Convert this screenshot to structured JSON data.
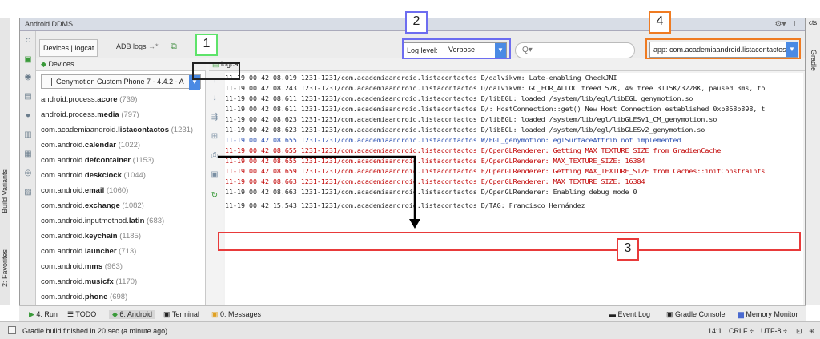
{
  "window": {
    "title": "Android DDMS"
  },
  "right_tab": {
    "label": "Gradle",
    "top_label": "cts"
  },
  "left_tabs": {
    "build_variants": "Build Variants",
    "favorites": "2: Favorites"
  },
  "toolbar": {
    "devices_tab": "Devices | logcat",
    "adb_logs_tab": "ADB logs",
    "log_level_label": "Log level:",
    "log_level_value": "Verbose",
    "search_placeholder": "Q▾",
    "app_filter": "app: com.academiaandroid.listacontactos"
  },
  "devices": {
    "header": "Devices",
    "selected": "Genymotion Custom Phone 7 - 4.4.2 - A",
    "processes": [
      {
        "pre": "android.process.",
        "bold": "acore",
        "post": "",
        "pid": "(739)"
      },
      {
        "pre": "android.process.",
        "bold": "media",
        "post": "",
        "pid": "(797)"
      },
      {
        "pre": "com.academiaandroid.",
        "bold": "listacontactos",
        "post": "",
        "pid": "(1231)"
      },
      {
        "pre": "com.android.",
        "bold": "calendar",
        "post": "",
        "pid": "(1022)"
      },
      {
        "pre": "com.android.",
        "bold": "defcontainer",
        "post": "",
        "pid": "(1153)"
      },
      {
        "pre": "com.android.",
        "bold": "deskclock",
        "post": "",
        "pid": "(1044)"
      },
      {
        "pre": "com.android.",
        "bold": "email",
        "post": "",
        "pid": "(1060)"
      },
      {
        "pre": "com.android.",
        "bold": "exchange",
        "post": "",
        "pid": "(1082)"
      },
      {
        "pre": "com.android.inputmethod.",
        "bold": "latin",
        "post": "",
        "pid": "(683)"
      },
      {
        "pre": "com.android.",
        "bold": "keychain",
        "post": "",
        "pid": "(1185)"
      },
      {
        "pre": "com.android.",
        "bold": "launcher",
        "post": "",
        "pid": "(713)"
      },
      {
        "pre": "com.android.",
        "bold": "mms",
        "post": "",
        "pid": "(963)"
      },
      {
        "pre": "com.android.",
        "bold": "musicfx",
        "post": "",
        "pid": "(1170)"
      },
      {
        "pre": "com.android.",
        "bold": "phone",
        "post": "",
        "pid": "(698)"
      }
    ]
  },
  "logcat": {
    "header": "logcat",
    "lines": [
      {
        "level": "d",
        "text": "11-19 00:42:08.019    1231-1231/com.academiaandroid.listacontactos D/dalvikvm:  Late-enabling CheckJNI"
      },
      {
        "level": "d",
        "text": "11-19 00:42:08.243    1231-1231/com.academiaandroid.listacontactos D/dalvikvm:  GC_FOR_ALLOC freed 57K, 4% free 3115K/3228K, paused 3ms, to"
      },
      {
        "level": "d",
        "text": "11-19 00:42:08.611    1231-1231/com.academiaandroid.listacontactos D/libEGL:  loaded /system/lib/egl/libEGL_genymotion.so"
      },
      {
        "level": "d",
        "text": "11-19 00:42:08.611    1231-1231/com.academiaandroid.listacontactos D/:  HostConnection::get() New Host Connection established 0xb868b898, t"
      },
      {
        "level": "d",
        "text": "11-19 00:42:08.623    1231-1231/com.academiaandroid.listacontactos D/libEGL:  loaded /system/lib/egl/libGLESv1_CM_genymotion.so"
      },
      {
        "level": "d",
        "text": "11-19 00:42:08.623    1231-1231/com.academiaandroid.listacontactos D/libEGL:  loaded /system/lib/egl/libGLESv2_genymotion.so"
      },
      {
        "level": "w",
        "text": "11-19 00:42:08.655    1231-1231/com.academiaandroid.listacontactos W/EGL_genymotion:  eglSurfaceAttrib not implemented"
      },
      {
        "level": "e",
        "text": "11-19 00:42:08.655    1231-1231/com.academiaandroid.listacontactos E/OpenGLRenderer:  Getting MAX_TEXTURE_SIZE from GradienCache"
      },
      {
        "level": "e",
        "text": "11-19 00:42:08.655    1231-1231/com.academiaandroid.listacontactos E/OpenGLRenderer:  MAX_TEXTURE_SIZE: 16384"
      },
      {
        "level": "e",
        "text": "11-19 00:42:08.659    1231-1231/com.academiaandroid.listacontactos E/OpenGLRenderer:  Getting MAX_TEXTURE_SIZE from Caches::initConstraints"
      },
      {
        "level": "e",
        "text": "11-19 00:42:08.663    1231-1231/com.academiaandroid.listacontactos E/OpenGLRenderer:  MAX_TEXTURE_SIZE: 16384"
      },
      {
        "level": "d",
        "text": "11-19 00:42:08.663    1231-1231/com.academiaandroid.listacontactos D/OpenGLRenderer:  Enabling debug mode 0"
      },
      {
        "level": "d",
        "text": "11-19 00:42:15.543    1231-1231/com.academiaandroid.listacontactos D/TAG:  Francisco Hernández"
      }
    ]
  },
  "bottom_tabs": {
    "run": "4: Run",
    "todo": "TODO",
    "android": "6: Android",
    "terminal": "Terminal",
    "messages": "0: Messages",
    "event_log": "Event Log",
    "gradle_console": "Gradle Console",
    "memory_monitor": "Memory Monitor"
  },
  "status": {
    "message": "Gradle build finished in 20 sec (a minute ago)",
    "position": "14:1",
    "line_sep": "CRLF ÷",
    "encoding": "UTF-8 ÷"
  },
  "annotations": {
    "n1": "1",
    "n2": "2",
    "n3": "3",
    "n4": "4",
    "color1": "#5ee36a",
    "color2": "#6d6df0",
    "color3": "#e83a3a",
    "color4": "#ef7b22"
  },
  "colors": {
    "error": "#c00000",
    "warn": "#2a4fb0",
    "accent": "#4a8ae4"
  }
}
